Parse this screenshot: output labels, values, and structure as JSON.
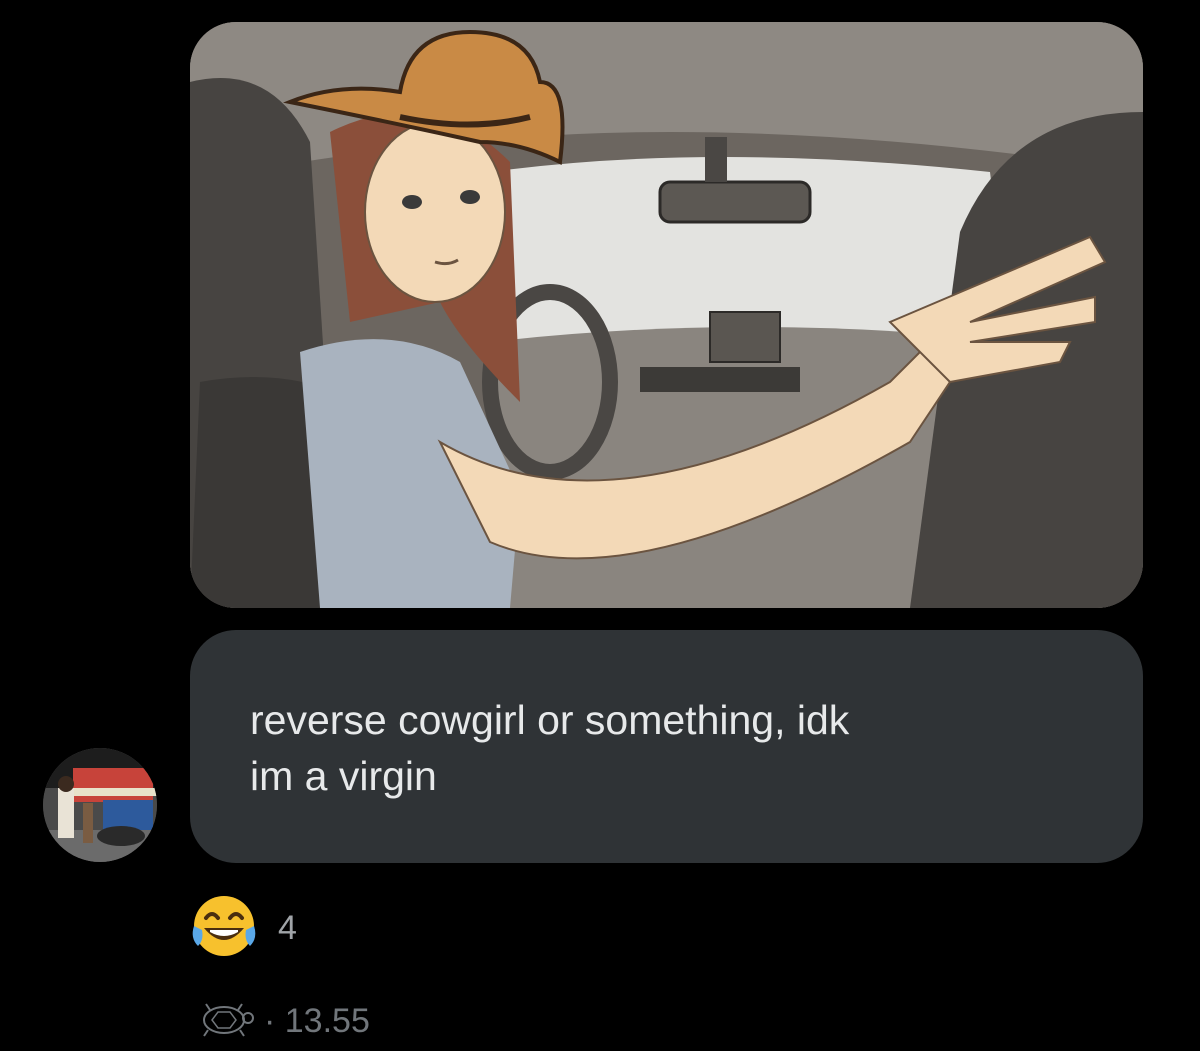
{
  "message": {
    "text": "reverse cowgirl or something, idk\nim a virgin"
  },
  "reaction": {
    "emoji_icon": "face-with-tears-of-joy-icon",
    "count": "4"
  },
  "meta": {
    "icon": "turtle-icon",
    "time": "· 13.55"
  },
  "colors": {
    "background": "#000000",
    "bubble": "#2f3336",
    "text": "#e7e9ea",
    "muted": "#71767b"
  }
}
